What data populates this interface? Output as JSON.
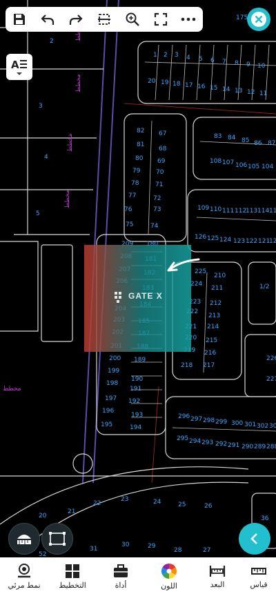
{
  "toolbar": {
    "icons": [
      "save-icon",
      "undo-icon",
      "redo-icon",
      "crop-icon",
      "zoom-icon",
      "fullscreen-icon",
      "more-icon"
    ],
    "close_icon": "close-icon"
  },
  "side": {
    "layers_icon": "text-layers-icon"
  },
  "watermark": {
    "text": "GATE X"
  },
  "colors": {
    "accent": "#22c0cf",
    "lot_numbers": "#3aa7ff",
    "labels": "#c13ad6",
    "lines": "#e0e0e0",
    "roads": "#5a4fa8"
  },
  "map": {
    "block_top_right": [
      "1",
      "2",
      "3",
      "4",
      "5",
      "6",
      "7",
      "8",
      "9",
      "10",
      "11",
      "12",
      "13",
      "14",
      "15",
      "16",
      "17",
      "18",
      "19",
      "20"
    ],
    "block_left_col_a": [
      "82",
      "81",
      "80",
      "79",
      "78",
      "77",
      "76",
      "75"
    ],
    "block_left_col_b": [
      "67",
      "68",
      "69",
      "70",
      "71",
      "72",
      "73",
      "74"
    ],
    "block_mid_right_top": [
      "83",
      "84",
      "85",
      "86",
      "87"
    ],
    "block_mid_right_bottom": [
      "108",
      "107",
      "106",
      "105",
      "104"
    ],
    "block_row2_top": [
      "109",
      "110",
      "111",
      "112",
      "113",
      "114",
      "115"
    ],
    "block_row2_bottom": [
      "126",
      "125",
      "124",
      "123",
      "122",
      "121",
      "120"
    ],
    "block_center_a": [
      "209",
      "208",
      "207",
      "206",
      "205",
      "204",
      "203",
      "202",
      "201",
      "200",
      "199",
      "198",
      "197",
      "196",
      "195"
    ],
    "block_center_b": [
      "180",
      "181",
      "182",
      "183",
      "184",
      "185",
      "186",
      "187",
      "188",
      "189",
      "190",
      "191",
      "192",
      "193",
      "194"
    ],
    "block_right_a": [
      "225",
      "224",
      "223",
      "222",
      "221",
      "220",
      "219",
      "218"
    ],
    "block_right_b": [
      "210",
      "211",
      "212",
      "213",
      "214",
      "215",
      "216",
      "217"
    ],
    "block_bottom_top": [
      "296",
      "297",
      "298",
      "299",
      "300",
      "301",
      "302",
      "303"
    ],
    "block_bottom_bottom": [
      "295",
      "294",
      "293",
      "292",
      "291",
      "290",
      "289",
      "288"
    ],
    "block_lower": [
      "22",
      "23",
      "24",
      "25",
      "26",
      "21",
      "20",
      "31",
      "30",
      "29",
      "28",
      "27",
      "36",
      "52"
    ],
    "left_parcels": [
      "2",
      "3",
      "4",
      "5"
    ],
    "misc": [
      "1/2",
      "226",
      "227",
      "175"
    ],
    "arabic_labels": [
      "مخطط",
      "مخطط",
      "مخطط",
      "مخطط",
      "مخطط"
    ]
  },
  "bottom_nav": [
    {
      "label": "نمط مرئي",
      "icon": "eye-icon"
    },
    {
      "label": "التخطيط",
      "icon": "grid-icon"
    },
    {
      "label": "أداة",
      "icon": "toolbox-icon"
    },
    {
      "label": "اللون",
      "icon": "color-wheel-icon"
    },
    {
      "label": "البعد",
      "icon": "ruler-icon"
    },
    {
      "label": "قياس",
      "icon": "measure-icon"
    }
  ]
}
